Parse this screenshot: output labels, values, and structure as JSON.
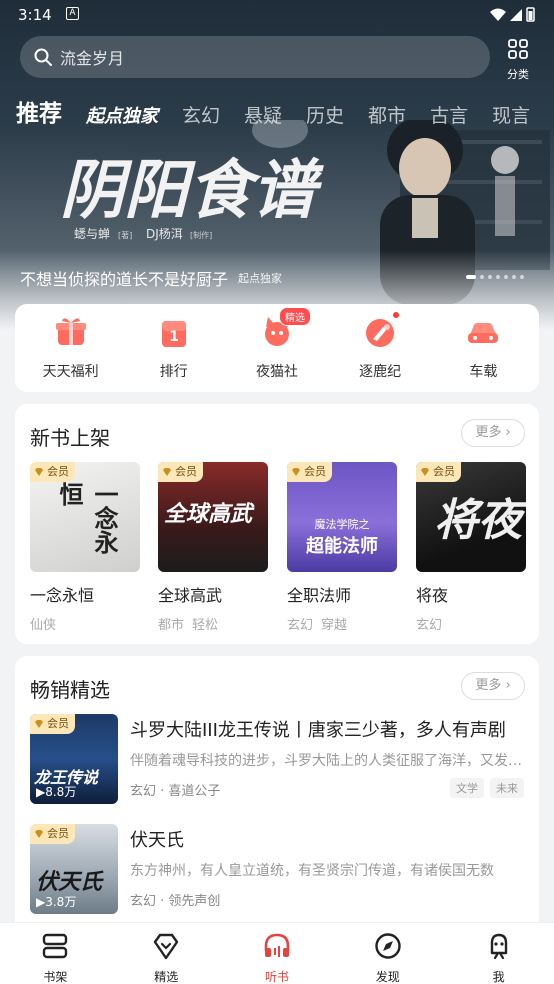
{
  "status": {
    "time": "3:14",
    "notif": "A"
  },
  "search": {
    "placeholder": "流金岁月"
  },
  "category_button": {
    "label": "分类"
  },
  "tabs": [
    {
      "label": "推荐"
    },
    {
      "label": "起点独家"
    },
    {
      "label": "玄幻"
    },
    {
      "label": "悬疑"
    },
    {
      "label": "历史"
    },
    {
      "label": "都市"
    },
    {
      "label": "古言"
    },
    {
      "label": "现言"
    }
  ],
  "banner": {
    "art_title": "阴阳食谱",
    "art_credit_1": "蟋与蝉",
    "art_credit_1_role": "[著]",
    "art_credit_2": "DJ杨洱",
    "art_credit_2_role": "[制作]",
    "title": "不想当侦探的道长不是好厨子",
    "tag": "起点独家",
    "slides": 7,
    "active_slide": 1
  },
  "quick_menu": [
    {
      "label": "天天福利",
      "icon": "gift-icon"
    },
    {
      "label": "排行",
      "icon": "rank-icon",
      "icon_text": "1"
    },
    {
      "label": "夜猫社",
      "icon": "cat-icon",
      "badge": "精选"
    },
    {
      "label": "逐鹿纪",
      "icon": "deer-icon",
      "dot": true
    },
    {
      "label": "车载",
      "icon": "car-icon"
    }
  ],
  "new_books": {
    "title": "新书上架",
    "more": "更多",
    "books": [
      {
        "badge": "会员",
        "name": "一念永恒",
        "tags": [
          "仙侠"
        ],
        "cover_text": "一念永恒"
      },
      {
        "badge": "会员",
        "name": "全球高武",
        "tags": [
          "都市",
          "轻松"
        ],
        "cover_text": "全球高武"
      },
      {
        "badge": "会员",
        "name": "全职法师",
        "tags": [
          "玄幻",
          "穿越"
        ],
        "cover_text_1": "魔法学院之",
        "cover_text_2": "超能法师"
      },
      {
        "badge": "会员",
        "name": "将夜",
        "tags": [
          "玄幻"
        ],
        "cover_text": "将夜"
      }
    ]
  },
  "bestsellers": {
    "title": "畅销精选",
    "more": "更多",
    "items": [
      {
        "badge": "会员",
        "plays": "8.8万",
        "title": "斗罗大陆III龙王传说丨唐家三少著，多人有声剧",
        "desc": "伴随着魂导科技的进步，斗罗大陆上的人类征服了海洋，又发现了两片大陆",
        "genre": "玄幻",
        "author": "喜道公子",
        "chips": [
          "文学",
          "未来"
        ],
        "cover_text": "龙王传说"
      },
      {
        "badge": "会员",
        "plays": "3.8万",
        "title": "伏天氏",
        "desc": "东方神州，有人皇立道统，有圣贤宗门传道，有诸侯国无数",
        "genre": "玄幻",
        "author": "领先声创",
        "chips": [],
        "cover_text": "伏天氏"
      }
    ]
  },
  "bottom_nav": [
    {
      "label": "书架",
      "icon": "bookshelf-icon"
    },
    {
      "label": "精选",
      "icon": "diamond-icon"
    },
    {
      "label": "听书",
      "icon": "headphones-icon",
      "active": true
    },
    {
      "label": "发现",
      "icon": "compass-icon"
    },
    {
      "label": "我",
      "icon": "profile-icon"
    }
  ],
  "colors": {
    "accent": "#e8423e",
    "vip_bg": "#fbe7b8",
    "vip_text": "#7a4f10"
  }
}
